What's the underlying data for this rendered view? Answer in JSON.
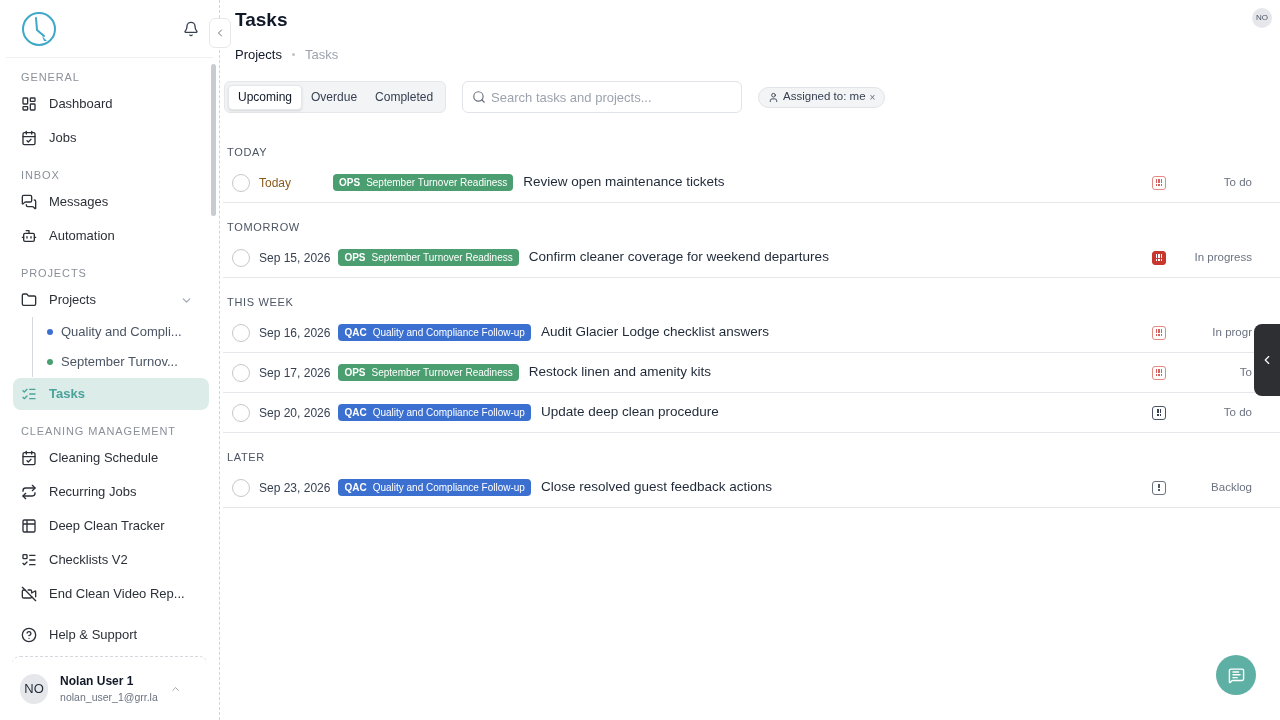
{
  "sidebar": {
    "sections": [
      {
        "heading": "GENERAL",
        "items": [
          {
            "label": "Dashboard",
            "selected": false
          },
          {
            "label": "Jobs",
            "selected": false
          }
        ]
      },
      {
        "heading": "INBOX",
        "items": [
          {
            "label": "Messages",
            "selected": false
          },
          {
            "label": "Automation",
            "selected": false
          }
        ]
      },
      {
        "heading": "PROJECTS",
        "items": [
          {
            "label": "Projects",
            "selected": false,
            "expanded": true,
            "children": [
              {
                "label": "Quality and Compli...",
                "color": "#3b6fd0"
              },
              {
                "label": "September Turnov...",
                "color": "#4a9e6f"
              }
            ]
          },
          {
            "label": "Tasks",
            "selected": true
          }
        ]
      },
      {
        "heading": "CLEANING MANAGEMENT",
        "items": [
          {
            "label": "Cleaning Schedule",
            "selected": false
          },
          {
            "label": "Recurring Jobs",
            "selected": false
          },
          {
            "label": "Deep Clean Tracker",
            "selected": false
          },
          {
            "label": "Checklists V2",
            "selected": false
          },
          {
            "label": "End Clean Video Rep...",
            "selected": false
          }
        ]
      }
    ],
    "help": "Help & Support",
    "user": {
      "initials": "NO",
      "name": "Nolan User 1",
      "email": "nolan_user_1@grr.la"
    }
  },
  "header": {
    "title": "Tasks",
    "avatar": "NO",
    "breadcrumb": [
      "Projects",
      "Tasks"
    ]
  },
  "tabs": [
    {
      "label": "Upcoming",
      "selected": true
    },
    {
      "label": "Overdue",
      "selected": false
    },
    {
      "label": "Completed",
      "selected": false
    }
  ],
  "search": {
    "placeholder": "Search tasks and projects..."
  },
  "filter": {
    "label": "Assigned to: me",
    "remove": "×"
  },
  "groups": [
    {
      "heading": "TODAY",
      "tasks": [
        {
          "checked": false,
          "date": "Today",
          "due_today": true,
          "tag": {
            "code": "OPS",
            "name": "September Turnover Readiness",
            "color": "#4a9e6f"
          },
          "title": "Review open maintenance tickets",
          "kind": "high",
          "status": "To do"
        }
      ]
    },
    {
      "heading": "TOMORROW",
      "tasks": [
        {
          "checked": false,
          "date": "Sep 15, 2026",
          "due_today": false,
          "tag": {
            "code": "OPS",
            "name": "September Turnover Readiness",
            "color": "#4a9e6f"
          },
          "title": "Confirm cleaner coverage for weekend departures",
          "kind": "urgent",
          "status": "In progress"
        }
      ]
    },
    {
      "heading": "THIS WEEK",
      "tasks": [
        {
          "checked": false,
          "date": "Sep 16, 2026",
          "due_today": false,
          "tag": {
            "code": "QAC",
            "name": "Quality and Compliance Follow-up",
            "color": "#3b6fd0"
          },
          "title": "Audit Glacier Lodge checklist answers",
          "kind": "high",
          "status": "In progr"
        },
        {
          "checked": false,
          "date": "Sep 17, 2026",
          "due_today": false,
          "tag": {
            "code": "OPS",
            "name": "September Turnover Readiness",
            "color": "#4a9e6f"
          },
          "title": "Restock linen and amenity kits",
          "kind": "high",
          "status": "To"
        },
        {
          "checked": false,
          "date": "Sep 20, 2026",
          "due_today": false,
          "tag": {
            "code": "QAC",
            "name": "Quality and Compliance Follow-up",
            "color": "#3b6fd0"
          },
          "title": "Update deep clean procedure",
          "kind": "medium",
          "status": "To do"
        }
      ]
    },
    {
      "heading": "LATER",
      "tasks": [
        {
          "checked": false,
          "date": "Sep 23, 2026",
          "due_today": false,
          "tag": {
            "code": "QAC",
            "name": "Quality and Compliance Follow-up",
            "color": "#3b6fd0"
          },
          "title": "Close resolved guest feedback actions",
          "kind": "low",
          "status": "Backlog"
        }
      ]
    }
  ]
}
